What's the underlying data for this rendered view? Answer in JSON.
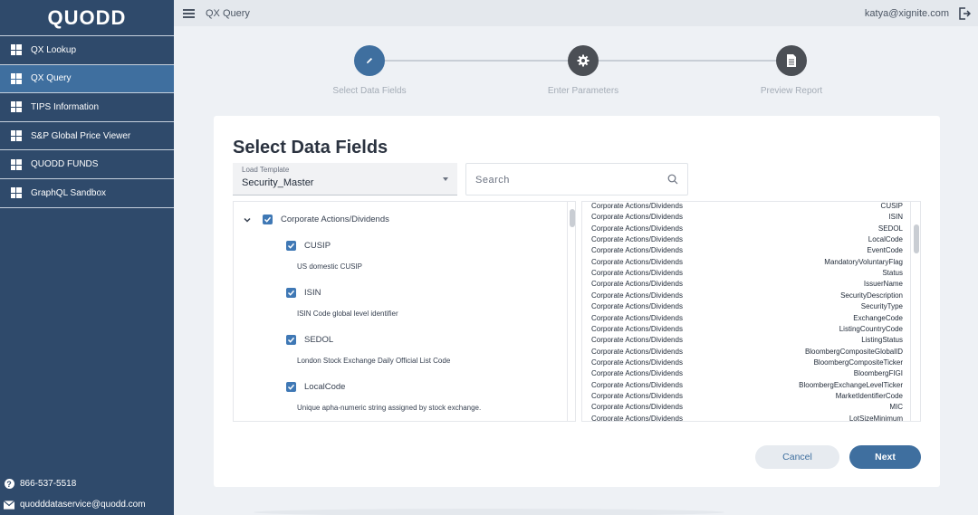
{
  "sidebar": {
    "logo": "QUODD",
    "items": [
      {
        "label": "QX Lookup",
        "active": false
      },
      {
        "label": "QX Query",
        "active": true
      },
      {
        "label": "TIPS Information",
        "active": false
      },
      {
        "label": "S&P Global Price Viewer",
        "active": false
      },
      {
        "label": "QUODD FUNDS",
        "active": false
      },
      {
        "label": "GraphQL Sandbox",
        "active": false
      }
    ],
    "phone": "866-537-5518",
    "email": "quodddataservice@quodd.com"
  },
  "topbar": {
    "title": "QX Query",
    "user": "katya@xignite.com"
  },
  "stepper": {
    "steps": [
      {
        "label": "Select Data Fields",
        "icon": "pencil-icon",
        "status": "active"
      },
      {
        "label": "Enter Parameters",
        "icon": "gear-icon",
        "status": "pending"
      },
      {
        "label": "Preview Report",
        "icon": "document-icon",
        "status": "pending"
      }
    ]
  },
  "main": {
    "title": "Select Data Fields",
    "template": {
      "label": "Load Template",
      "value": "Security_Master"
    },
    "search": {
      "placeholder": "Search"
    },
    "tree": {
      "group": {
        "label": "Corporate Actions/Dividends",
        "checked": true,
        "expanded": true
      },
      "fields": [
        {
          "label": "CUSIP",
          "description": "US domestic CUSIP",
          "checked": true
        },
        {
          "label": "ISIN",
          "description": "ISIN Code global level identifier",
          "checked": true
        },
        {
          "label": "SEDOL",
          "description": "London Stock Exchange Daily Official List Code",
          "checked": true
        },
        {
          "label": "LocalCode",
          "description": "Unique apha-numeric string assigned by stock exchange.",
          "checked": true
        }
      ]
    },
    "selected": [
      {
        "category": "Corporate Actions/Dividends",
        "field": "CUSIP"
      },
      {
        "category": "Corporate Actions/Dividends",
        "field": "ISIN"
      },
      {
        "category": "Corporate Actions/Dividends",
        "field": "SEDOL"
      },
      {
        "category": "Corporate Actions/Dividends",
        "field": "LocalCode"
      },
      {
        "category": "Corporate Actions/Dividends",
        "field": "EventCode"
      },
      {
        "category": "Corporate Actions/Dividends",
        "field": "MandatoryVoluntaryFlag"
      },
      {
        "category": "Corporate Actions/Dividends",
        "field": "Status"
      },
      {
        "category": "Corporate Actions/Dividends",
        "field": "IssuerName"
      },
      {
        "category": "Corporate Actions/Dividends",
        "field": "SecurityDescription"
      },
      {
        "category": "Corporate Actions/Dividends",
        "field": "SecurityType"
      },
      {
        "category": "Corporate Actions/Dividends",
        "field": "ExchangeCode"
      },
      {
        "category": "Corporate Actions/Dividends",
        "field": "ListingCountryCode"
      },
      {
        "category": "Corporate Actions/Dividends",
        "field": "ListingStatus"
      },
      {
        "category": "Corporate Actions/Dividends",
        "field": "BloombergCompositeGlobalID"
      },
      {
        "category": "Corporate Actions/Dividends",
        "field": "BloombergCompositeTicker"
      },
      {
        "category": "Corporate Actions/Dividends",
        "field": "BloombergFIGI"
      },
      {
        "category": "Corporate Actions/Dividends",
        "field": "BloombergExchangeLevelTicker"
      },
      {
        "category": "Corporate Actions/Dividends",
        "field": "MarketIdentifierCode"
      },
      {
        "category": "Corporate Actions/Dividends",
        "field": "MIC"
      },
      {
        "category": "Corporate Actions/Dividends",
        "field": "LotSizeMinimum"
      }
    ],
    "buttons": {
      "cancel": "Cancel",
      "next": "Next"
    }
  },
  "colors": {
    "sidebar_bg": "#2f4a6b",
    "sidebar_active": "#3f6f9f",
    "accent": "#3f6f9f",
    "checkbox": "#3f78b5"
  }
}
